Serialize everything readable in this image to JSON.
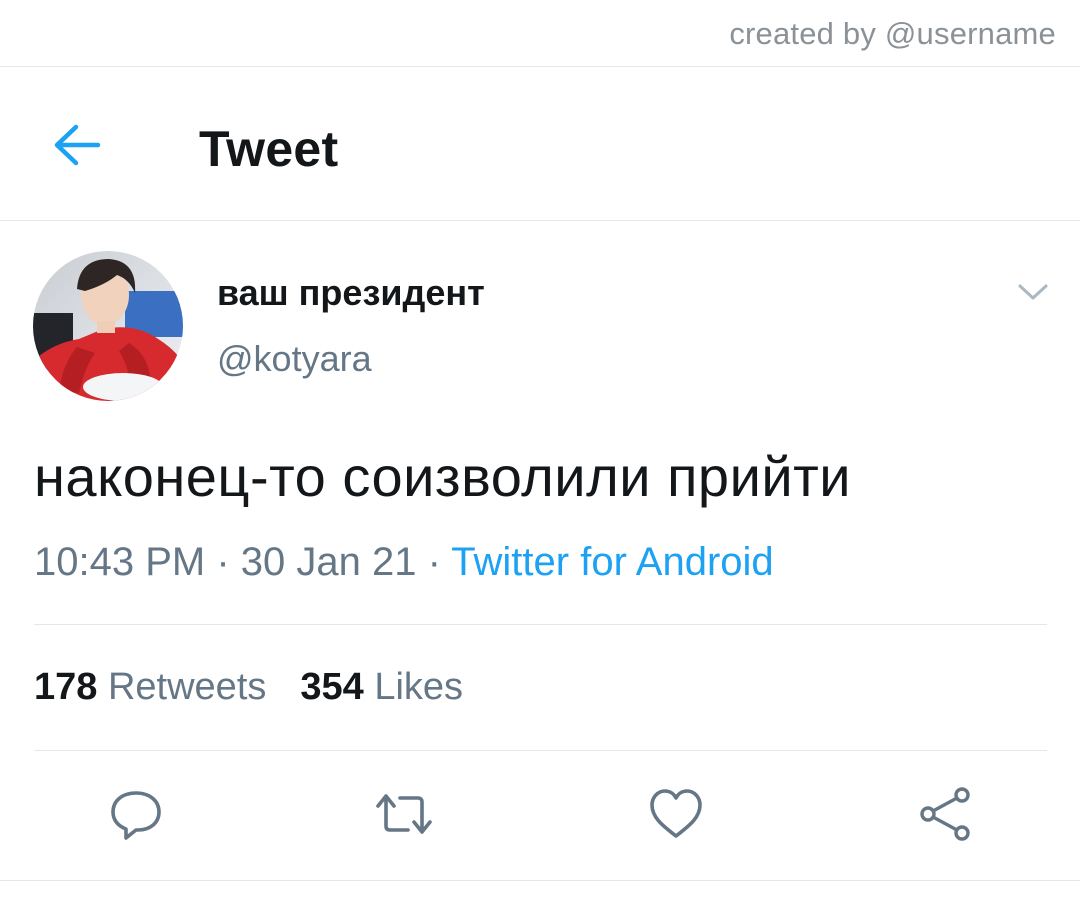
{
  "watermark": {
    "text": "created by @username"
  },
  "header": {
    "title": "Tweet",
    "back_icon": "arrow-left-icon",
    "accent_color": "#1da1f2"
  },
  "tweet": {
    "author": {
      "display_name": "ваш президент",
      "handle": "@kotyara"
    },
    "text": "наконец-то соизволили прийти",
    "time": "10:43 PM",
    "separator": " · ",
    "date": "30 Jan 21",
    "source": "Twitter for Android",
    "stats": {
      "retweets_count": "178",
      "retweets_label": "Retweets",
      "likes_count": "354",
      "likes_label": "Likes"
    }
  },
  "actions": [
    {
      "icon": "reply-icon"
    },
    {
      "icon": "retweet-icon"
    },
    {
      "icon": "like-heart-icon"
    },
    {
      "icon": "share-icon"
    }
  ],
  "colors": {
    "text_primary": "#14171a",
    "text_secondary": "#657786",
    "link": "#1da1f2",
    "divider": "#e1e8ed"
  }
}
